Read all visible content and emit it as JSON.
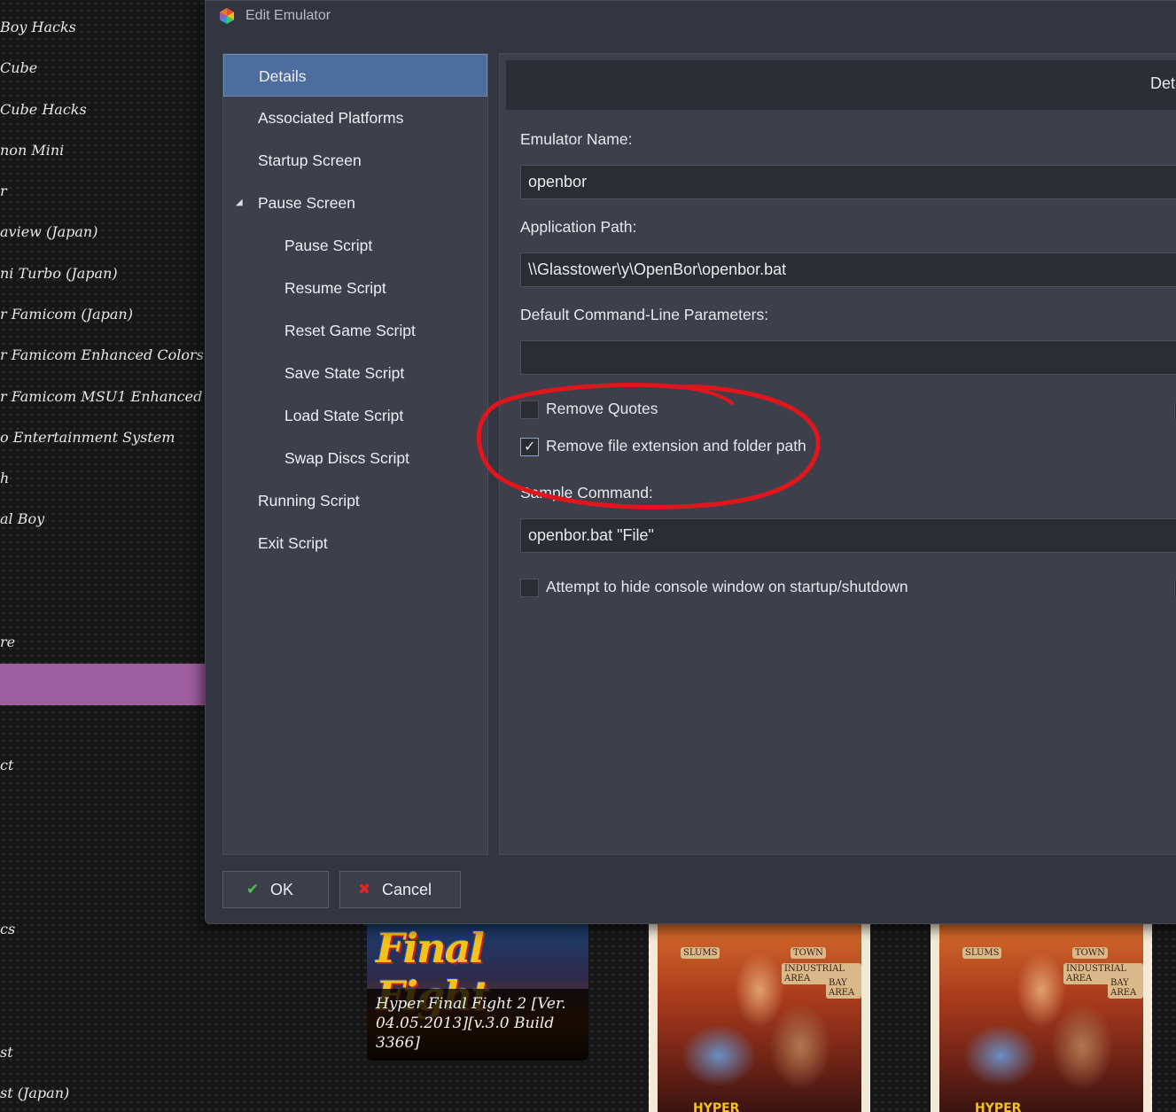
{
  "left_list": {
    "items": [
      "Boy Hacks",
      "Cube",
      "Cube Hacks",
      "non Mini",
      "r",
      "aview (Japan)",
      "ni Turbo (Japan)",
      "r Famicom (Japan)",
      "r Famicom Enhanced Colors",
      "r Famicom MSU1 Enhanced",
      "o Entertainment System",
      "h",
      "al Boy",
      "re",
      "ct",
      "cs",
      "st",
      "st (Japan)"
    ],
    "highlight_color": "#9e5e9f"
  },
  "dialog": {
    "title": "Edit Emulator",
    "nav": {
      "items": [
        "Details",
        "Associated Platforms",
        "Startup Screen",
        "Pause Screen",
        "Pause Script",
        "Resume Script",
        "Reset Game Script",
        "Save State Script",
        "Load State Script",
        "Swap Discs Script",
        "Running Script",
        "Exit Script"
      ],
      "selected": "Details",
      "expand_arrow": "◢"
    },
    "content": {
      "header": "Details",
      "emulator_name_label": "Emulator Name:",
      "emulator_name_value": "openbor",
      "app_path_label": "Application Path:",
      "app_path_value": "\\\\Glasstower\\y\\OpenBor\\openbor.bat",
      "cmd_params_label": "Default Command-Line Parameters:",
      "cmd_params_value": "",
      "remove_quotes_label": "Remove Quotes",
      "remove_quotes_checked": false,
      "remove_ext_label": "Remove file extension and folder path",
      "remove_ext_checked": true,
      "sample_command_label": "Sample Command:",
      "sample_command_value": "openbor.bat \"File\"",
      "hide_console_label": "Attempt to hide console window on startup/shutdown",
      "hide_console_checked": false,
      "check_glyph": "✓"
    },
    "buttons": {
      "ok_label": "OK",
      "ok_icon": "check-icon",
      "ok_glyph": "✔",
      "cancel_label": "Cancel",
      "cancel_icon": "close-icon",
      "cancel_glyph": "✖"
    }
  },
  "games": {
    "tile1_logo": "Final Fight",
    "tile1_caption": "Hyper Final Fight 2 [Ver. 04.05.2013][v.3.0 Build 3366]",
    "tile_art_signs": [
      "SLUMS",
      "TOWN",
      "INDUSTRIAL AREA",
      "BAY AREA"
    ],
    "tile_art_bottom": "HYPER"
  },
  "colors": {
    "accent_selected": "#4c6d9e",
    "annotation_red": "#e0161c",
    "ok_green": "#4cc04a",
    "cancel_red": "#d8262c"
  }
}
